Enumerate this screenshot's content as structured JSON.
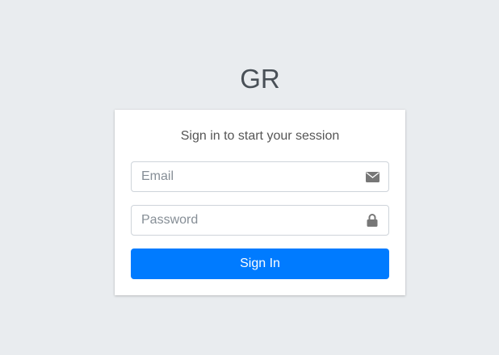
{
  "logo": {
    "text": "GR"
  },
  "login": {
    "message": "Sign in to start your session",
    "email": {
      "value": "",
      "placeholder": "Email",
      "icon": "envelope-icon"
    },
    "password": {
      "value": "",
      "placeholder": "Password",
      "icon": "lock-icon"
    },
    "submit_label": "Sign In"
  },
  "colors": {
    "background": "#e9ecef",
    "card": "#ffffff",
    "primary_button": "#007bff",
    "icon": "#777777"
  }
}
